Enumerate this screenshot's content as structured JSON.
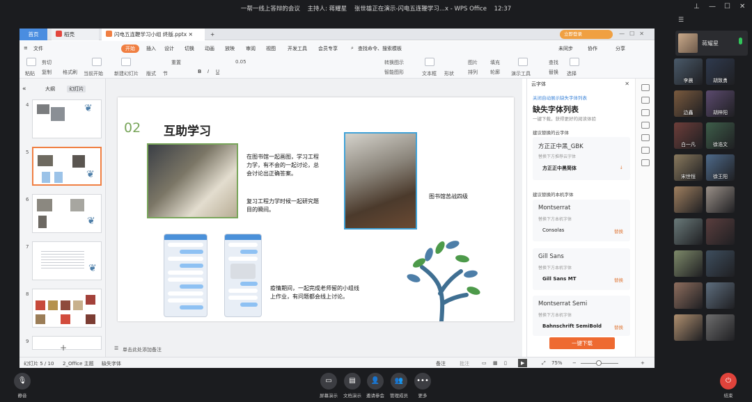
{
  "meeting": {
    "title": "一帮一线上答辩的会议",
    "host": "主持人: 蒋耀星",
    "presenting": "张世雄正在演示-闪电五连鞭学习...x - WPS Office",
    "time": "12:37"
  },
  "wps": {
    "tabs": {
      "home": "首页",
      "docer": "稻壳",
      "doc": "闪电五连鞭学习小组 终版.pptx"
    },
    "login_label": "立即登录",
    "menu": [
      "文件",
      "开始",
      "插入",
      "设计",
      "切换",
      "动画",
      "放映",
      "审阅",
      "视图",
      "开发工具",
      "会员专享"
    ],
    "menu_active": "开始",
    "search": "查找命令、搜索模板",
    "right_menu": [
      "未同步",
      "协作",
      "分享"
    ],
    "ribbon": {
      "paste": "粘贴",
      "cut": "剪切",
      "copy": "复制",
      "format_painter": "格式刷",
      "start_current": "当前开始",
      "new_slide": "新建幻灯片",
      "layout": "版式",
      "section": "节",
      "reset": "重置",
      "font_size": "0.05",
      "text_box": "文本框",
      "shape": "形状",
      "arrange": "排列",
      "outline": "轮廓",
      "present_tools": "演示工具",
      "find": "查找",
      "replace": "替换",
      "select": "选择",
      "picture": "图片",
      "fill": "填充",
      "convert_art": "转换图示",
      "smart_art": "智能图形"
    },
    "left_tabs": [
      "大纲",
      "幻灯片"
    ],
    "left_tab_active": "幻灯片",
    "thumb_numbers": [
      "4",
      "5",
      "6",
      "7",
      "8",
      "9"
    ],
    "slide": {
      "number": "02",
      "title": "互助学习",
      "text1": "在图书馆一起画图，学习工程力学，有不会的一起讨论，总会讨论出正确答案。",
      "text2": "复习工程力学时候一起研究题目的瞬间。",
      "caption_right": "图书馆苦战四级",
      "text3": "疫情期间，一起完成老师留的小组线上作业，有问题都会线上讨论。"
    },
    "notes_placeholder": "单击此处添加备注",
    "right_panel": {
      "header": "云字体",
      "link": "关闭自动展示缺失字体列表",
      "title": "缺失字体列表",
      "subtitle": "一键下载，获得更好的阅读体验",
      "section_cloud": "建议替换的云字体",
      "section_local": "建议替换的本机字体",
      "fonts": [
        {
          "name": "方正正中黑_GBK",
          "hint": "替换下方推荐云字体",
          "alt": "方正正中黑简体",
          "action": "↓"
        },
        {
          "name": "Montserrat",
          "hint": "替换下方本机字体",
          "alt": "Consolas",
          "action": "替换"
        },
        {
          "name": "Gill Sans",
          "hint": "替换下方本机字体",
          "alt": "Gill Sans MT",
          "action": "替换"
        },
        {
          "name": "Montserrat Semi",
          "hint": "替换下方本机字体",
          "alt": "Bahnschrift SemiBold",
          "action": "替换"
        }
      ],
      "download": "一键下载"
    },
    "status": {
      "slide_pos": "幻灯片 5 / 10",
      "theme": "2_Office 主题",
      "missing_font": "缺失字体",
      "notes": "备注",
      "comments": "批注",
      "zoom": "75%"
    }
  },
  "participants": {
    "host_name": "蒋耀星",
    "list": [
      "李晨",
      "胡致勇",
      "边鑫",
      "胡梓阳",
      "白一凡",
      "徐浩文",
      "宋世恒",
      "徐王阳",
      "",
      "",
      "",
      "",
      "",
      "",
      "",
      "",
      "",
      ""
    ]
  },
  "bottom": [
    "静音",
    "屏幕演示",
    "文档演示",
    "邀请参会",
    "管理成员",
    "更多",
    "结束"
  ]
}
